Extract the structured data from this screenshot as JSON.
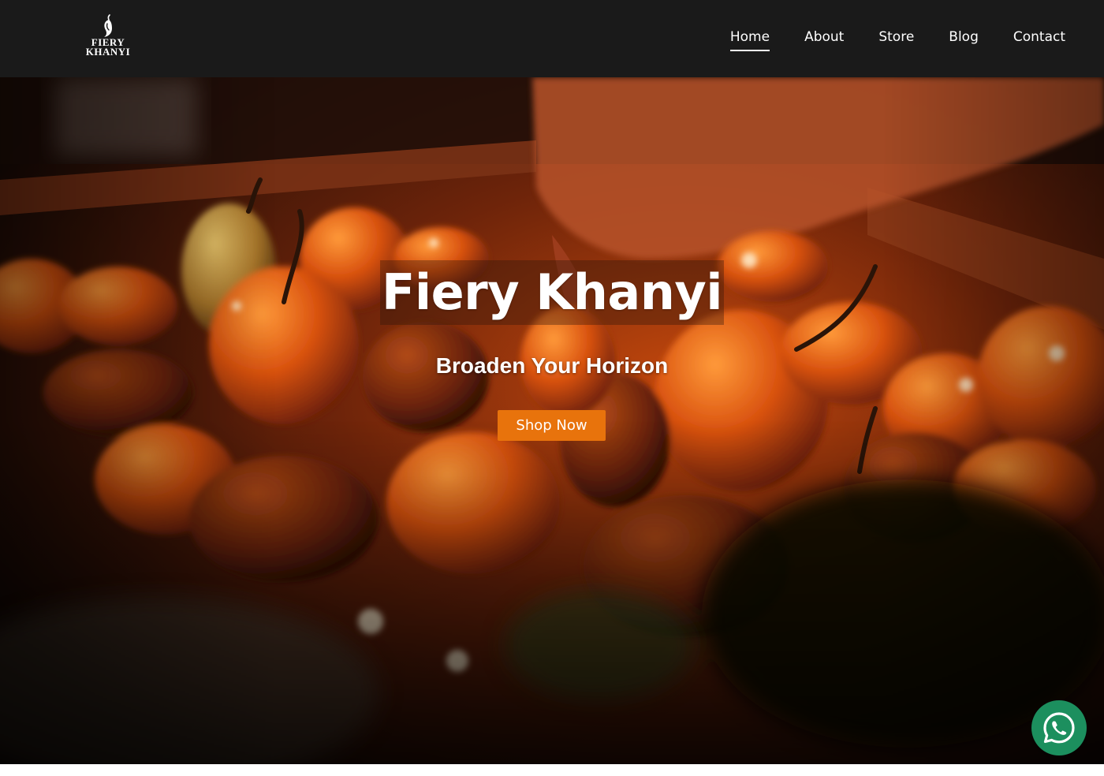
{
  "header": {
    "logo": {
      "line1": "FIERY",
      "line2": "KHANYI",
      "icon": "chili-pepper-icon"
    },
    "nav": [
      {
        "label": "Home",
        "active": true
      },
      {
        "label": "About",
        "active": false
      },
      {
        "label": "Store",
        "active": false
      },
      {
        "label": "Blog",
        "active": false
      },
      {
        "label": "Contact",
        "active": false
      }
    ]
  },
  "hero": {
    "title": "Fiery Khanyi",
    "subtitle": "Broaden Your Horizon",
    "cta_label": "Shop Now",
    "background": "photo of orange habanero peppers in a crate with a hand picking one"
  },
  "floating": {
    "whatsapp_icon": "whatsapp-icon"
  },
  "colors": {
    "header_bg": "#1a1a1a",
    "accent": "#e8730c",
    "whatsapp": "#1c8f5e"
  }
}
